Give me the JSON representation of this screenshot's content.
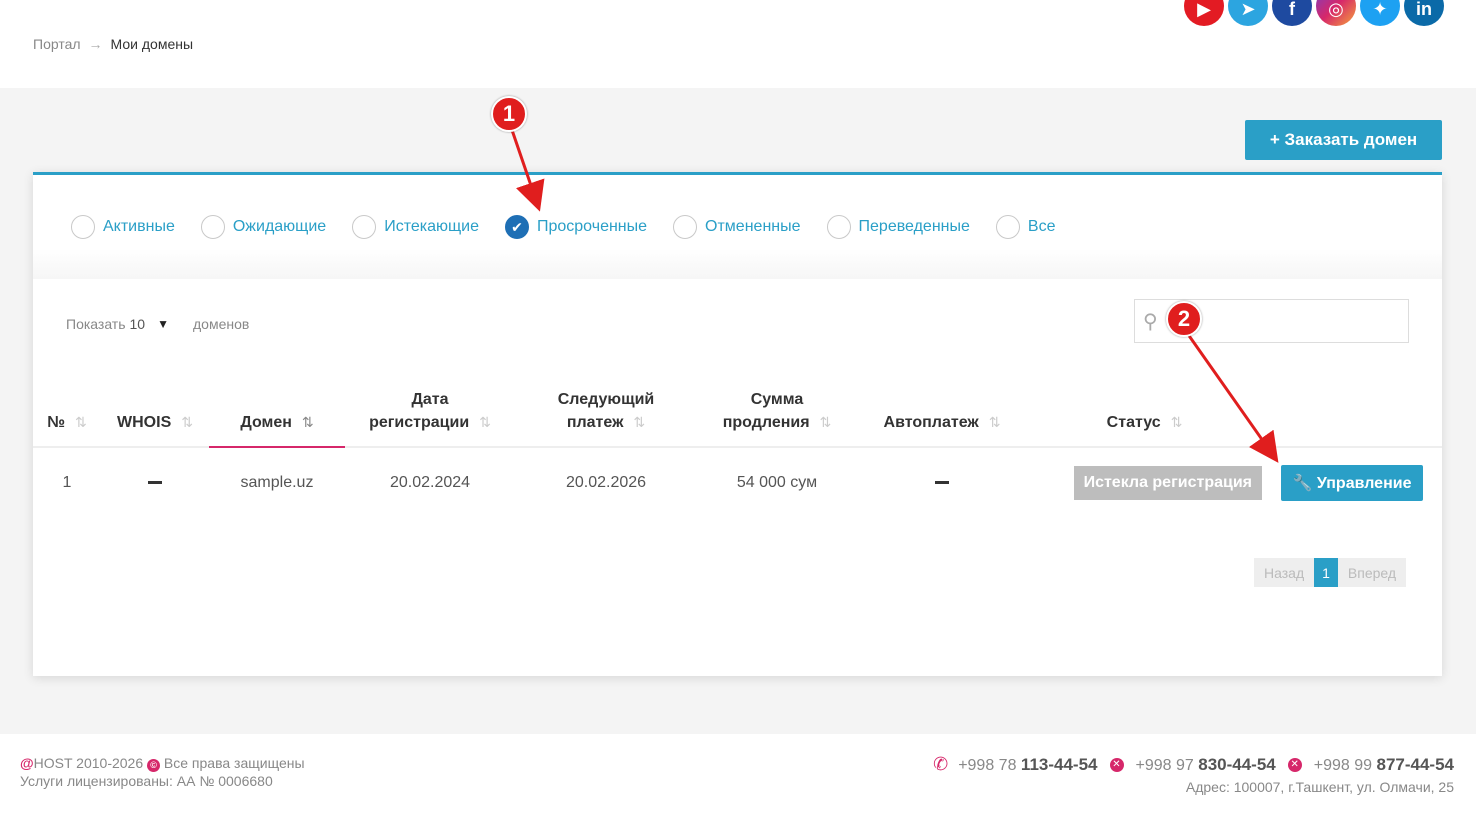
{
  "breadcrumb": {
    "home": "Портал",
    "current": "Мои домены"
  },
  "social": [
    "youtube-icon",
    "telegram-icon",
    "facebook-icon",
    "instagram-icon",
    "twitter-icon",
    "linkedin-icon"
  ],
  "actions": {
    "order_domain": "+ Заказать домен"
  },
  "filters": [
    {
      "label": "Активные",
      "checked": false
    },
    {
      "label": "Ожидающие",
      "checked": false
    },
    {
      "label": "Истекающие",
      "checked": false
    },
    {
      "label": "Просроченные",
      "checked": true
    },
    {
      "label": "Отмененные",
      "checked": false
    },
    {
      "label": "Переведенные",
      "checked": false
    },
    {
      "label": "Все",
      "checked": false
    }
  ],
  "page_size": {
    "prefix": "Показать",
    "value": "10",
    "suffix": "доменов"
  },
  "table": {
    "headers": [
      "№",
      "WHOIS",
      "Домен",
      "Дата регистрации",
      "Следующий платеж",
      "Сумма продления",
      "Автоплатеж",
      "Статус",
      ""
    ],
    "rows": [
      {
        "num": "1",
        "domain": "sample.uz",
        "reg_date": "20.02.2024",
        "next_payment": "20.02.2026",
        "renewal": "54 000 сум",
        "status": "Истекла регистрация",
        "action": "Управление"
      }
    ]
  },
  "pagination": {
    "prev": "Назад",
    "current": "1",
    "next": "Вперед"
  },
  "footer": {
    "brand": "@",
    "copyright": "HOST 2010-2026",
    "rights": "Все права защищены",
    "license": "Услуги лицензированы: АА № 0006680",
    "phones": [
      {
        "prefix": "+998 78",
        "number": "113-44-54"
      },
      {
        "prefix": "+998 97",
        "number": "830-44-54"
      },
      {
        "prefix": "+998 99",
        "number": "877-44-54"
      }
    ],
    "address": "Адрес: 100007, г.Ташкент, ул. Олмачи, 25"
  },
  "annotations": [
    "1",
    "2"
  ],
  "colors": {
    "accent": "#2a9fc7",
    "brand_pink": "#d6276a",
    "annotation_red": "#e01e1e",
    "checked_radio": "#1e6fb5"
  }
}
